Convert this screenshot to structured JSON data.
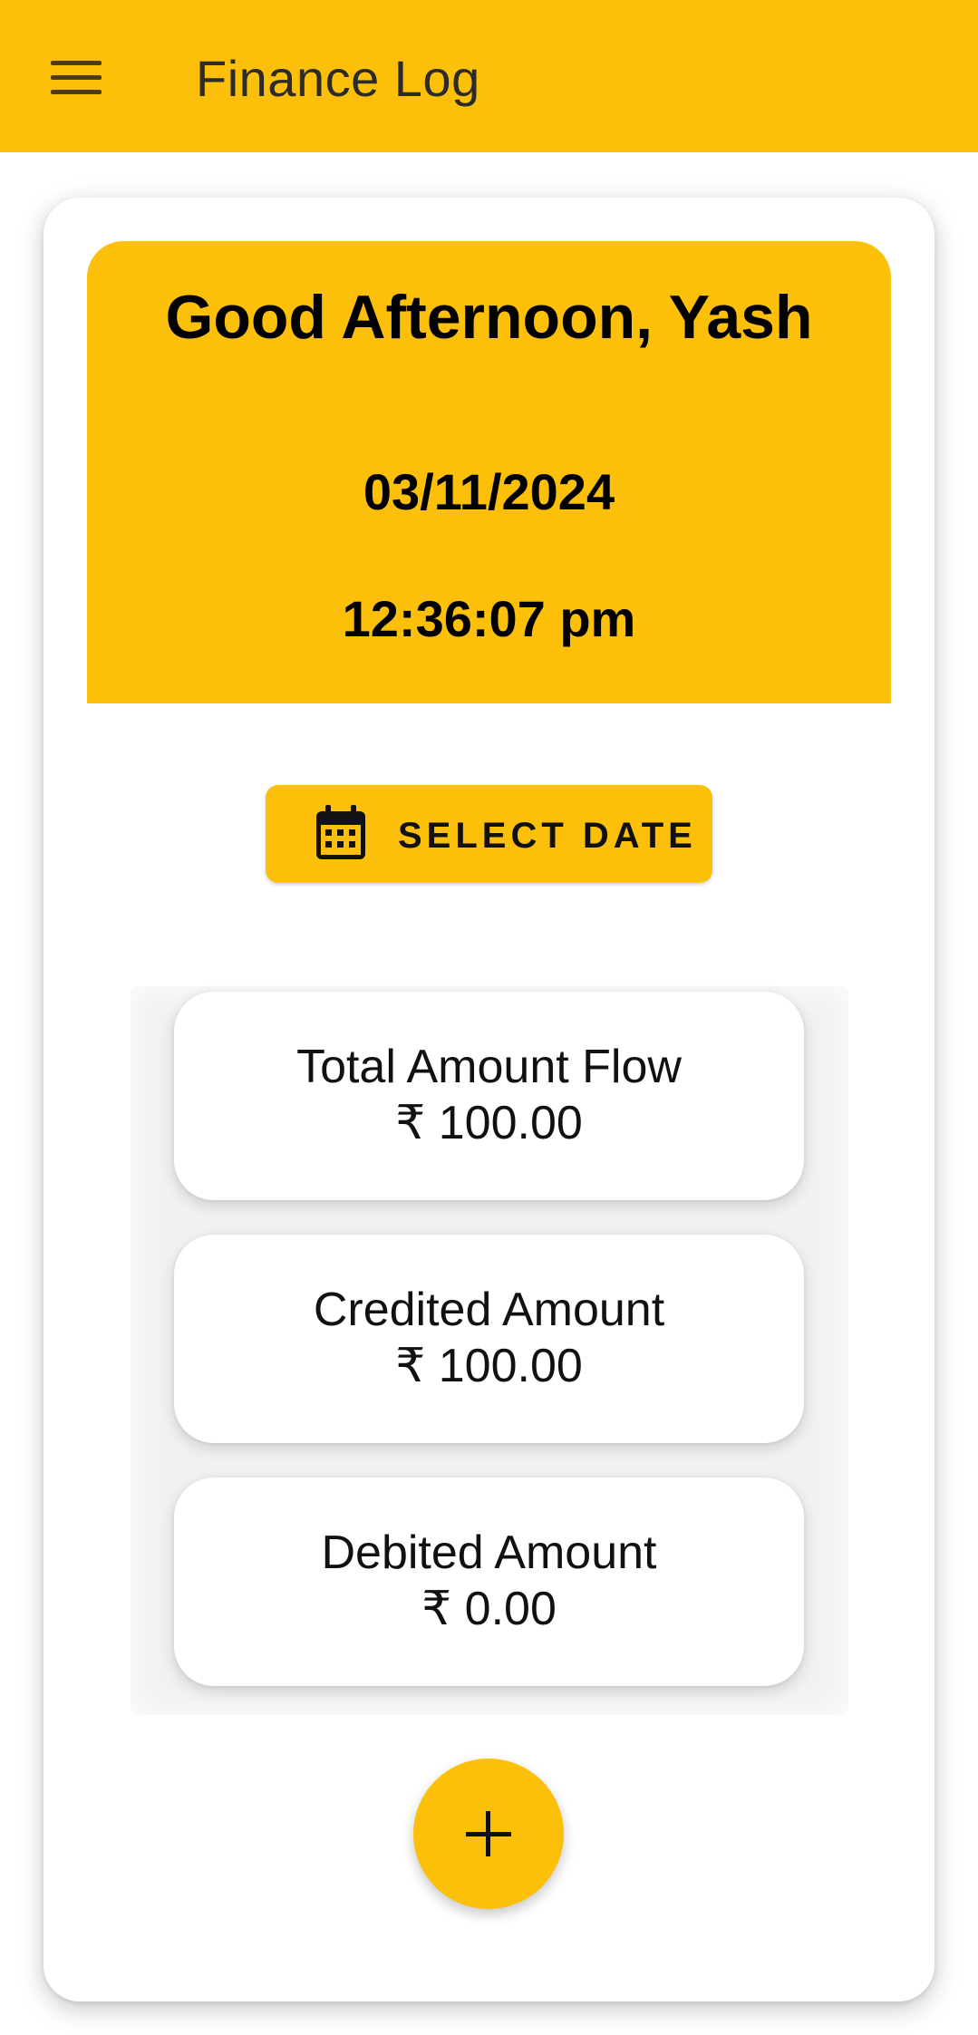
{
  "app_bar": {
    "title": "Finance Log",
    "menu_icon": "menu-icon",
    "background": "#FCBF0A"
  },
  "greeting": {
    "text": "Good Afternoon, Yash",
    "date": "03/11/2024",
    "time": "12:36:07 pm"
  },
  "select_date": {
    "label": "SELECT DATE",
    "icon": "calendar-icon"
  },
  "summary": [
    {
      "label": "Total Amount Flow",
      "value": "₹ 100.00"
    },
    {
      "label": "Credited Amount",
      "value": "₹ 100.00"
    },
    {
      "label": "Debited Amount",
      "value": "₹ 0.00"
    }
  ],
  "fab": {
    "icon": "plus-icon"
  },
  "colors": {
    "accent": "#FCBF0A",
    "card": "#FFFFFF",
    "text": "#000000"
  }
}
